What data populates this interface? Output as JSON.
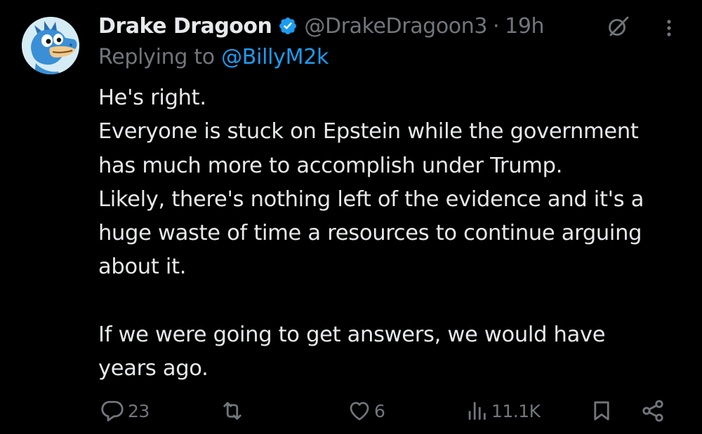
{
  "tweet": {
    "display_name": "Drake Dragoon",
    "handle": "@DrakeDragoon3",
    "separator": "·",
    "time": "19h",
    "reply_prefix": "Replying to",
    "reply_mention": "@BillyM2k",
    "lines": [
      "He's right.",
      "Everyone is stuck on Epstein while the government",
      "has much more to accomplish under Trump.",
      "Likely, there's nothing left of the evidence and it's a",
      "huge waste of time a resources to continue arguing",
      "about it.",
      "",
      "If we were going to get answers, we would have",
      "years ago."
    ]
  },
  "actions": {
    "replies": "23",
    "reposts": "",
    "likes": "6",
    "views": "11.1K"
  },
  "icons": {
    "verified": "verified-badge-icon",
    "grok": "grok-icon",
    "more": "more-vertical-icon",
    "reply": "reply-icon",
    "repost": "repost-icon",
    "like": "heart-icon",
    "views": "views-icon",
    "bookmark": "bookmark-icon",
    "share": "share-icon"
  },
  "colors": {
    "background": "#000000",
    "text": "#e7e9ea",
    "muted": "#71767b",
    "accent": "#1d9bf0"
  }
}
